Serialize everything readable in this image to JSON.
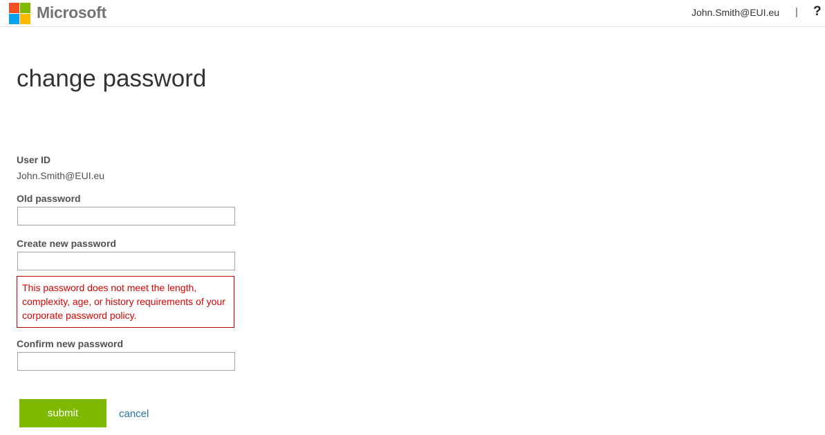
{
  "header": {
    "brand": "Microsoft",
    "user_email": "John.Smith@EUI.eu",
    "separator": "|",
    "help": "?"
  },
  "colors": {
    "logo_red": "#f25022",
    "logo_green": "#7fba00",
    "logo_blue": "#00a4ef",
    "logo_yellow": "#ffb900",
    "submit_green": "#7fba00",
    "error_red": "#e00000",
    "link_blue": "#2672a8"
  },
  "page": {
    "title": "change password"
  },
  "form": {
    "user_id_label": "User ID",
    "user_id_value": "John.Smith@EUI.eu",
    "old_password_label": "Old password",
    "old_password_value": "",
    "new_password_label": "Create new password",
    "new_password_value": "",
    "error_message": "This password does not meet the length, complexity, age, or history requirements of your corporate password policy.",
    "confirm_password_label": "Confirm new password",
    "confirm_password_value": "",
    "submit_label": "submit",
    "cancel_label": "cancel"
  }
}
